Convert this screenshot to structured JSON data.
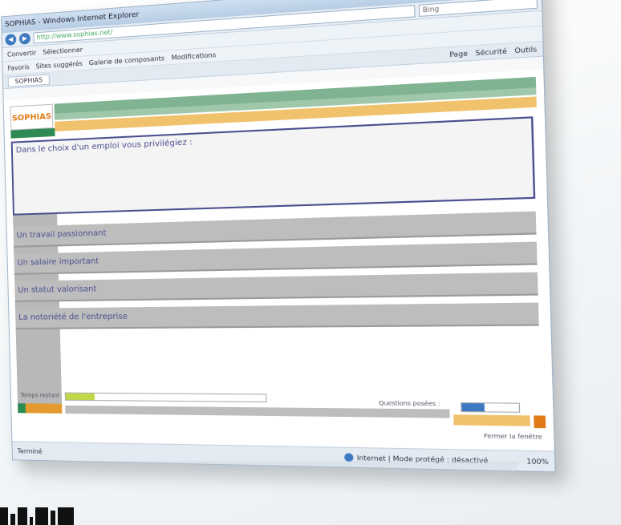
{
  "window": {
    "title": "SOPHIAS - Windows Internet Explorer",
    "controls": {
      "minimize": "–",
      "maximize": "□",
      "close": "✕"
    }
  },
  "address_bar": {
    "url": "http://www.sophias.net/",
    "search_placeholder": "Bing"
  },
  "menubar": {
    "items": [
      "Convertir",
      "Sélectionner"
    ]
  },
  "favorites_bar": {
    "items": [
      "Favoris",
      "Sites suggérés",
      "Galerie de composants",
      "Modifications"
    ]
  },
  "tabs": [
    {
      "label": "SOPHIAS"
    }
  ],
  "toolbar": {
    "items": [
      "Page",
      "Sécurité",
      "Outils"
    ]
  },
  "page": {
    "logo": "SOPHIAS",
    "question": "Dans le choix d'un emploi vous privilégiez :",
    "answers": [
      "Un travail passionnant",
      "Un salaire important",
      "Un statut valorisant",
      "La notoriété de l'entreprise"
    ],
    "progress_label": "Temps restant",
    "progress_fraction": 0.15,
    "questions_label": "Questions posées :",
    "questions_fraction": 0.4,
    "link_text": "Fermer la fenêtre"
  },
  "statusbar": {
    "left": "Terminé",
    "zone": "Internet | Mode protégé : désactivé",
    "zoom": "100%"
  }
}
